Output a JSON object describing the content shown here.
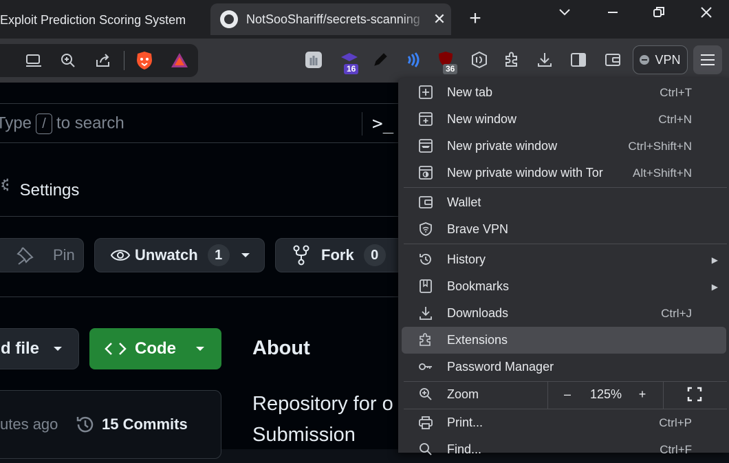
{
  "tabs": {
    "inactive_title": "Exploit Prediction Scoring System",
    "active_title": "NotSooShariff/secrets-scanning",
    "close": "✕",
    "new_tab": "+"
  },
  "window": {
    "minimize": "—",
    "restore": "❐",
    "close": "✕",
    "tabs_dropdown": "⌄"
  },
  "toolbar": {
    "extension_badges": {
      "academic": "16",
      "ublock": "36"
    },
    "vpn_label": "VPN"
  },
  "page": {
    "search_prefix": "Type",
    "search_key": "/",
    "search_suffix": "to search",
    "terminal_glyph": ">_",
    "settings_label": "Settings",
    "pin_label": "Pin",
    "unwatch_label": "Unwatch",
    "unwatch_count": "1",
    "fork_label": "Fork",
    "fork_count": "0",
    "add_file_label": "d file",
    "code_label": "Code",
    "about_heading": "About",
    "repo_desc_line1": "Repository for o",
    "repo_desc_line2": "Submission",
    "last_commit_time": "utes ago",
    "commits_label": "15 Commits"
  },
  "menu": {
    "items": [
      {
        "label": "New tab",
        "shortcut": "Ctrl+T",
        "icon": "new-tab-icon"
      },
      {
        "label": "New window",
        "shortcut": "Ctrl+N",
        "icon": "new-window-icon"
      },
      {
        "label": "New private window",
        "shortcut": "Ctrl+Shift+N",
        "icon": "private-window-icon"
      },
      {
        "label": "New private window with Tor",
        "shortcut": "Alt+Shift+N",
        "icon": "tor-window-icon"
      },
      {
        "label": "Wallet",
        "shortcut": "",
        "icon": "wallet-icon"
      },
      {
        "label": "Brave VPN",
        "shortcut": "",
        "icon": "vpn-shield-icon"
      },
      {
        "label": "History",
        "shortcut": "",
        "icon": "history-icon"
      },
      {
        "label": "Bookmarks",
        "shortcut": "",
        "icon": "bookmarks-icon"
      },
      {
        "label": "Downloads",
        "shortcut": "Ctrl+J",
        "icon": "download-icon"
      },
      {
        "label": "Extensions",
        "shortcut": "",
        "icon": "puzzle-icon"
      },
      {
        "label": "Password Manager",
        "shortcut": "",
        "icon": "key-icon"
      },
      {
        "label": "Zoom",
        "shortcut": "",
        "icon": "zoom-icon"
      },
      {
        "label": "Print...",
        "shortcut": "Ctrl+P",
        "icon": "print-icon"
      },
      {
        "label": "Find...",
        "shortcut": "Ctrl+F",
        "icon": "find-icon"
      }
    ],
    "zoom": {
      "minus": "–",
      "value": "125%",
      "plus": "+"
    }
  }
}
